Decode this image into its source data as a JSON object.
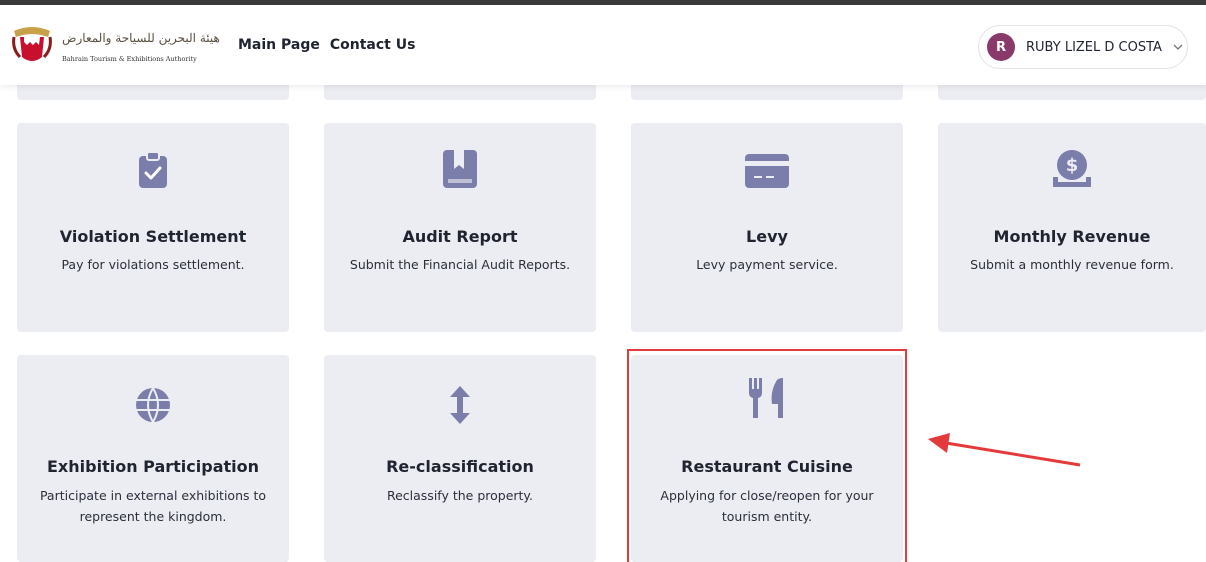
{
  "header": {
    "logo": {
      "arabic_text": "هيئة البحرين للسياحة والمعارض",
      "english_text": "Bahrain Tourism & Exhibitions Authority"
    },
    "nav": [
      {
        "label": "Main Page"
      },
      {
        "label": "Contact Us"
      }
    ],
    "user": {
      "initial": "R",
      "name": "RUBY LIZEL D COSTA"
    }
  },
  "cards": [
    {
      "title": "Violation Settlement",
      "desc": "Pay for violations settlement.",
      "icon": "clipboard-check-icon"
    },
    {
      "title": "Audit Report",
      "desc": "Submit the Financial Audit Reports.",
      "icon": "book-bookmark-icon"
    },
    {
      "title": "Levy",
      "desc": "Levy payment service.",
      "icon": "credit-card-icon"
    },
    {
      "title": "Monthly Revenue",
      "desc": "Submit a monthly revenue form.",
      "icon": "coin-in-hand-icon"
    },
    {
      "title": "Exhibition Participation",
      "desc": "Participate in external exhibitions to represent the kingdom.",
      "icon": "globe-icon"
    },
    {
      "title": "Re-classification",
      "desc": "Reclassify the property.",
      "icon": "vertical-arrows-icon"
    },
    {
      "title": "Restaurant Cuisine",
      "desc": "Applying for close/reopen for your tourism entity.",
      "icon": "fork-knife-icon"
    }
  ],
  "colors": {
    "icon": "#7b7dab",
    "card_bg": "#ecedf3",
    "highlight": "#e33b3b",
    "avatar": "#8a3a6a"
  }
}
